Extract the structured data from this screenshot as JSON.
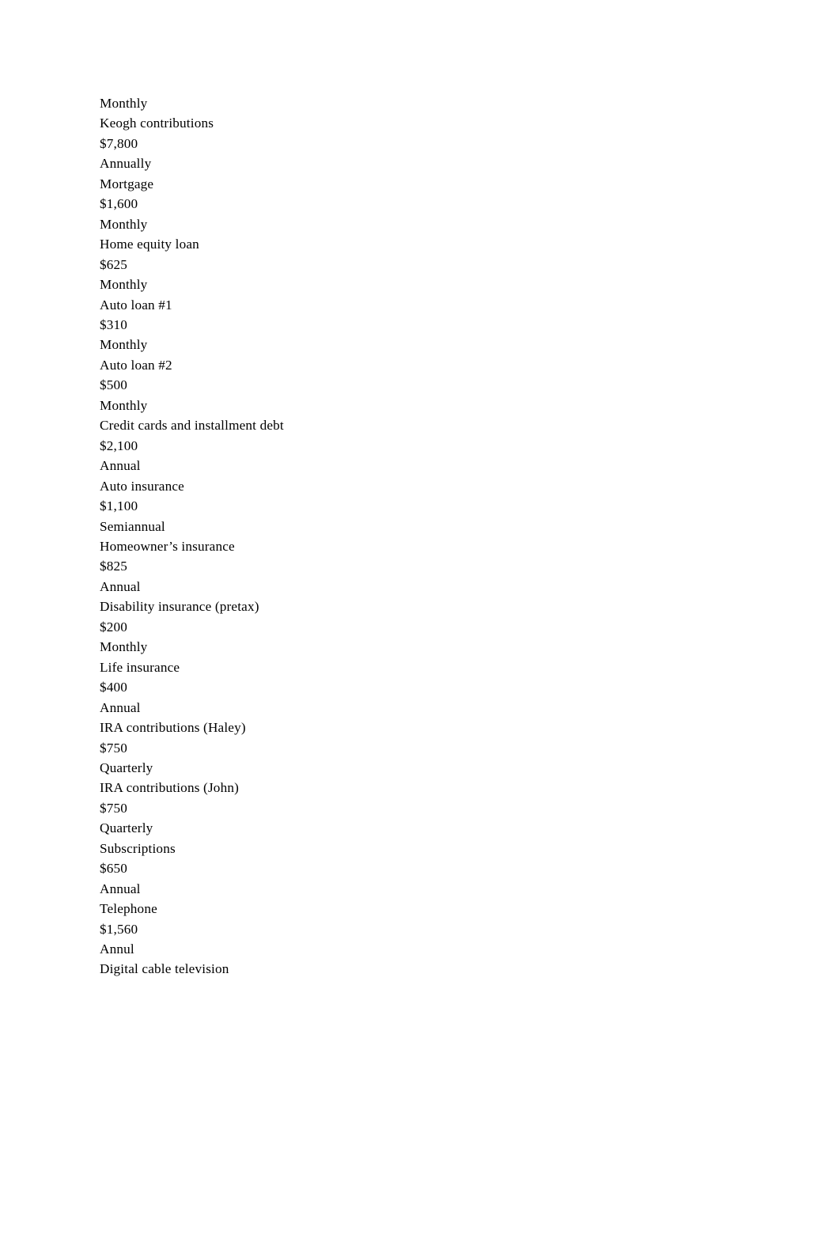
{
  "document": {
    "background_color": "#ffffff",
    "text_color": "#000000",
    "lines": [
      "Monthly",
      "Keogh contributions",
      "$7,800",
      "Annually",
      "Mortgage",
      "$1,600",
      "Monthly",
      "Home equity loan",
      "$625",
      "Monthly",
      "Auto loan #1",
      "$310",
      "Monthly",
      "Auto loan #2",
      "$500",
      "Monthly",
      "Credit cards and installment debt",
      "$2,100",
      "Annual",
      "Auto insurance",
      "$1,100",
      "Semiannual",
      "Homeowner’s insurance",
      "$825",
      "Annual",
      "Disability insurance (pretax)",
      "$200",
      "Monthly",
      "Life insurance",
      "$400",
      "Annual",
      "IRA contributions (Haley)",
      "$750",
      "Quarterly",
      "IRA contributions (John)",
      "$750",
      "Quarterly",
      "Subscriptions",
      "$650",
      "Annual",
      "Telephone",
      "$1,560",
      "Annul",
      "Digital cable television"
    ]
  }
}
